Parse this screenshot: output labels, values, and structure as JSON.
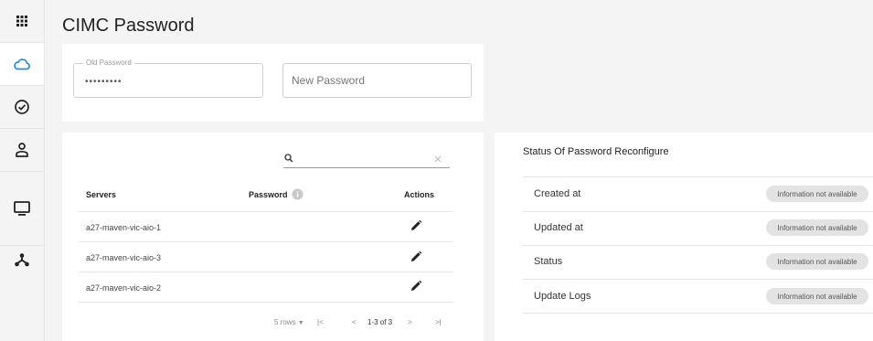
{
  "page": {
    "title": "CIMC Password"
  },
  "sidebar": {
    "items": [
      {
        "icon": "apps-grid-icon",
        "label": ""
      },
      {
        "icon": "cloud-icon",
        "label": ""
      },
      {
        "icon": "check-circle-icon",
        "label": ""
      },
      {
        "icon": "user-icon",
        "label": ""
      },
      {
        "icon": "monitor-icon",
        "label": ""
      },
      {
        "icon": "network-icon",
        "label": ""
      }
    ],
    "active_index": 1,
    "accent_color": "#2a8bd8"
  },
  "password_form": {
    "old_password": {
      "label": "Old Password",
      "value": "•••••••••"
    },
    "new_password": {
      "placeholder": "New Password",
      "value": ""
    }
  },
  "servers_table": {
    "search": {
      "value": "",
      "icon": "search-icon",
      "clear_icon": "close-icon"
    },
    "columns": [
      "Servers",
      "Password",
      "Actions"
    ],
    "password_info_icon": "info-icon",
    "rows": [
      {
        "server": "a27-maven-vic-aio-1",
        "action_icon": "edit-pencil-icon"
      },
      {
        "server": "a27-maven-vic-aio-3",
        "action_icon": "edit-pencil-icon"
      },
      {
        "server": "a27-maven-vic-aio-2",
        "action_icon": "edit-pencil-icon"
      }
    ],
    "pagination": {
      "rows_per_page": "5 rows",
      "range": "1-3 of 3",
      "first": "|<",
      "prev": "<",
      "next": ">",
      "last": ">|"
    }
  },
  "status_panel": {
    "title": "Status Of Password Reconfigure",
    "rows": [
      {
        "label": "Created at",
        "value": "Information not available"
      },
      {
        "label": "Updated at",
        "value": "Information not available"
      },
      {
        "label": "Status",
        "value": "Information not available"
      },
      {
        "label": "Update Logs",
        "value": "Information not available"
      }
    ]
  }
}
